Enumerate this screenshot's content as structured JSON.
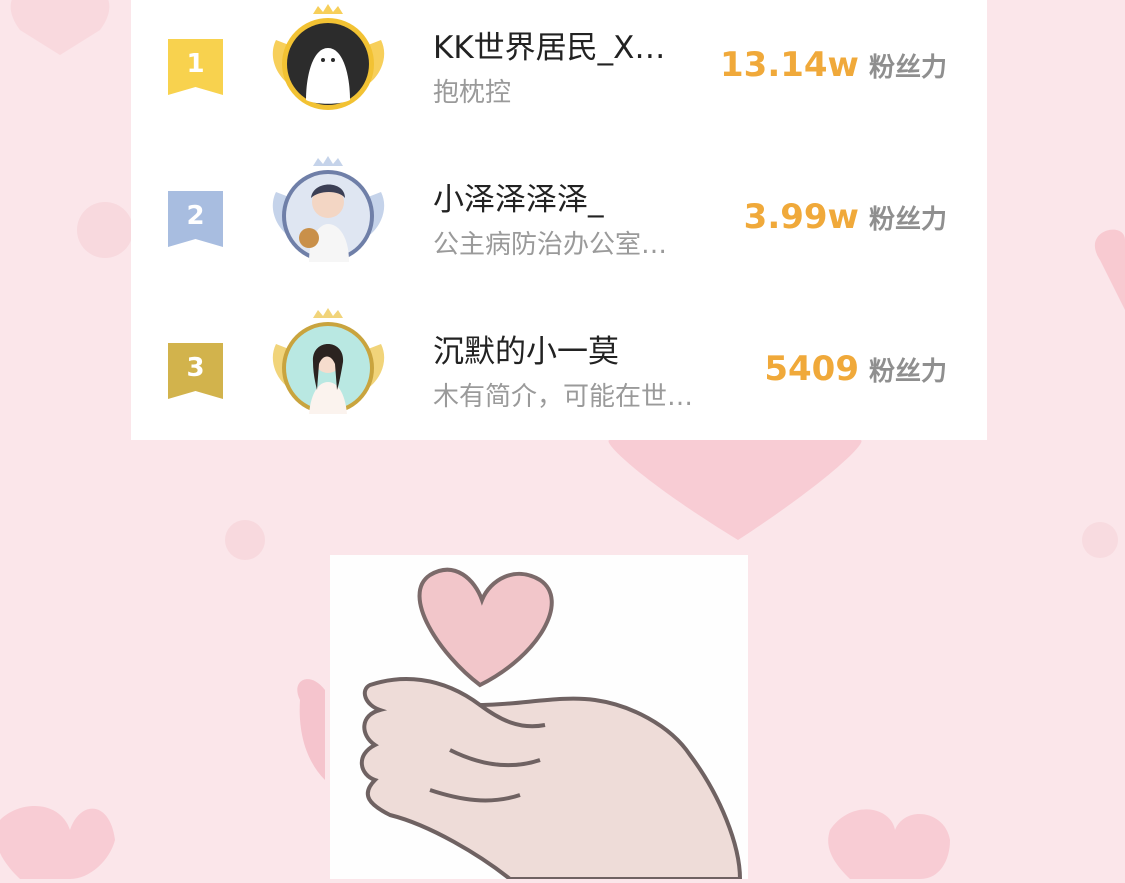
{
  "ranking": [
    {
      "rank": "1",
      "name": "KK世界居民_X…",
      "bio": "抱枕控",
      "fans": "13.14w",
      "fans_unit": "粉丝力",
      "badge_color": "#f8d24e",
      "ring_color": "#f2c233"
    },
    {
      "rank": "2",
      "name": "小泽泽泽泽_",
      "bio": "公主病防治办公室…",
      "fans": "3.99w",
      "fans_unit": "粉丝力",
      "badge_color": "#a8bde0",
      "ring_color": "#b6c7e3"
    },
    {
      "rank": "3",
      "name": "沉默的小一莫",
      "bio": "木有简介，可能在世…",
      "fans": "5409",
      "fans_unit": "粉丝力",
      "badge_color": "#d2b34c",
      "ring_color": "#e0c05a"
    }
  ],
  "colors": {
    "background": "#fbe6ea",
    "heart": "#f6c9d0",
    "fans_number": "#f0a93a"
  },
  "icons": {
    "rank_badge": "ribbon-badge-icon",
    "avatar_frame": "winged-crown-frame-icon",
    "sticker": "finger-heart-sticker"
  }
}
